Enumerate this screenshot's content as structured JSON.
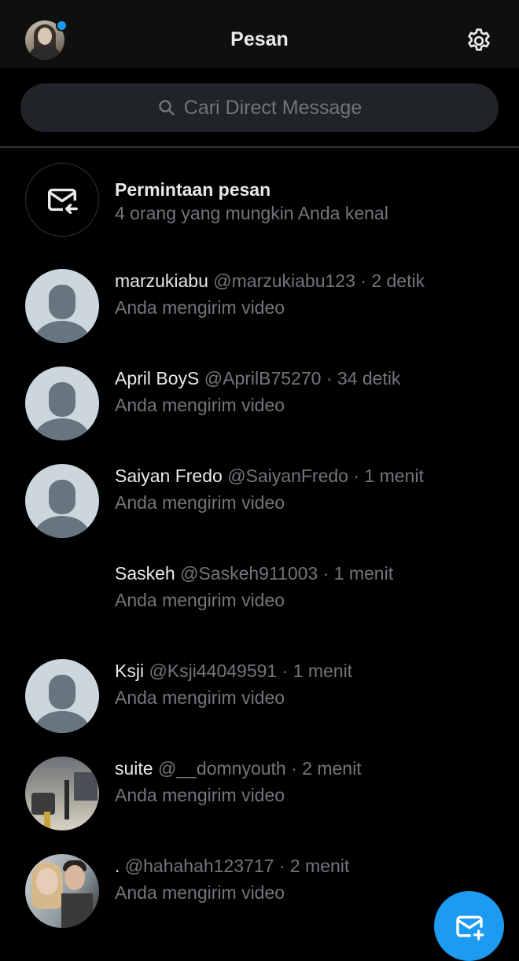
{
  "header": {
    "title": "Pesan",
    "avatar_icon": "profile-avatar",
    "settings_icon": "gear-icon"
  },
  "search": {
    "placeholder": "Cari Direct Message"
  },
  "message_requests": {
    "title": "Permintaan pesan",
    "subtitle": "4 orang yang mungkin Anda kenal"
  },
  "conversations": [
    {
      "name": "marzukiabu",
      "handle": "@marzukiabu123",
      "time": "· 2 detik",
      "preview": "Anda mengirim video",
      "avatar": "default"
    },
    {
      "name": "April BoyS",
      "handle": "@AprilB75270",
      "time": "· 34 detik",
      "preview": "Anda mengirim video",
      "avatar": "default"
    },
    {
      "name": "Saiyan Fredo",
      "handle": "@SaiyanFredo",
      "time": "· 1 menit",
      "preview": "Anda mengirim video",
      "avatar": "default"
    },
    {
      "name": "Saskeh",
      "handle": "@Saskeh911003",
      "time": "· 1 menit",
      "preview": "Anda mengirim video",
      "avatar": "none"
    },
    {
      "name": "Ksji",
      "handle": "@Ksji44049591",
      "time": "· 1 menit",
      "preview": "Anda mengirim video",
      "avatar": "default"
    },
    {
      "name": "suite",
      "handle": "@__domnyouth",
      "time": "· 2 menit",
      "preview": "Anda mengirim video",
      "avatar": "photo"
    },
    {
      "name": ".",
      "handle": "@hahahah123717",
      "time": "· 2 menit",
      "preview": "Anda mengirim video",
      "avatar": "photo"
    }
  ],
  "colors": {
    "accent": "#1d9bf0",
    "background": "#000000",
    "secondary_text": "#71767b"
  },
  "fab_icon": "new-message-icon"
}
